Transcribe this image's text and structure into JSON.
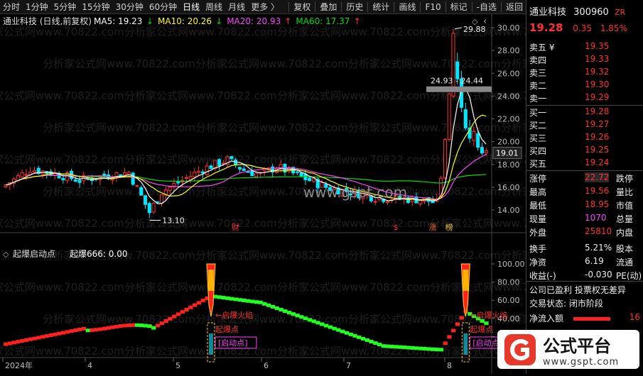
{
  "toolbar": {
    "periods": [
      "分时",
      "1分钟",
      "5分钟",
      "15分钟",
      "30分钟",
      "60分钟",
      "日线",
      "周线",
      "月线",
      "更多 〉"
    ],
    "active_period": "日线",
    "actions": [
      "复权",
      "叠加",
      "历史",
      "统计",
      "画线",
      "F10",
      "标记",
      "-自选",
      "返回"
    ]
  },
  "main_chart": {
    "title": "通业科技 (日线,前复权)",
    "ma": [
      {
        "label": "MA5: 19.23",
        "arrow": "↓",
        "color": "#ffffff"
      },
      {
        "label": "MA10: 20.26",
        "arrow": "↓",
        "color": "#ffff00"
      },
      {
        "label": "MA20: 20.93",
        "arrow": "↑",
        "color": "#ff40ff"
      },
      {
        "label": "MA60: 17.37",
        "arrow": "↑",
        "color": "#00e000"
      }
    ],
    "y_ticks": [
      "30.00",
      "28.00",
      "26.00",
      "24.00",
      "22.00",
      "20.00",
      "18.00",
      "16.00",
      "14.00"
    ],
    "high_label": "29.88",
    "low_label": "13.10",
    "last_price_tag": "19.01",
    "range_label": "24.93 - 24.44",
    "event_marks": [
      "财",
      "$",
      "涨",
      "榜"
    ],
    "watermark": "www.gspt.com"
  },
  "indicator": {
    "title": "起爆启动点",
    "value_label": "起爆666: 0.00",
    "y_ticks": [
      "100.00",
      "80.00",
      "60.00",
      "40.00",
      "20.00"
    ],
    "signals": [
      "启爆火焰",
      "起爆点",
      "启动点"
    ]
  },
  "x_axis": {
    "labels": [
      "2024年",
      "4",
      "5",
      "6",
      "7",
      "8"
    ]
  },
  "watermark_text": "分析家公式网www.70822.com",
  "quote": {
    "name": "通业科技",
    "code": "300960",
    "badge": "ZR",
    "price": "19.28",
    "change": "0.35",
    "pct": "1.85%",
    "asks": [
      {
        "label": "卖五 ¥",
        "price": "19.35"
      },
      {
        "label": "卖四",
        "price": "19.33"
      },
      {
        "label": "卖三",
        "price": "19.32"
      },
      {
        "label": "卖二",
        "price": "19.30"
      },
      {
        "label": "卖一",
        "price": "19.29"
      }
    ],
    "bids": [
      {
        "label": "买一",
        "price": "19.28"
      },
      {
        "label": "买二",
        "price": "19.27"
      },
      {
        "label": "买三",
        "price": "19.26"
      },
      {
        "label": "买四",
        "price": "19.25"
      },
      {
        "label": "买五",
        "price": "19.24"
      }
    ],
    "stats": [
      {
        "label": "涨停",
        "value": "22.72",
        "label2": "跌停",
        "color": "red"
      },
      {
        "label": "最高",
        "value": "19.56",
        "label2": "量比",
        "color": "red"
      },
      {
        "label": "最低",
        "value": "18.95",
        "label2": "市值",
        "color": "red"
      },
      {
        "label": "现量",
        "value": "1070",
        "label2": "总量",
        "color": "mag"
      },
      {
        "label": "外盘",
        "value": "25810",
        "label2": "内盘",
        "color": "red"
      },
      {
        "label": "换手",
        "value": "5.21%",
        "label2": "股本",
        "color": "white"
      },
      {
        "label": "净资",
        "value": "6.19",
        "label2": "流通",
        "color": "white"
      },
      {
        "label": "收益(-)",
        "value": "-0.030",
        "label2": "PE(动)",
        "color": "white"
      }
    ],
    "notes": [
      "公司已盈利 投票权无差异",
      "交易状态: 闭市阶段"
    ],
    "netflow_label": "净流入额",
    "netflow_value": "16"
  },
  "logo": {
    "cn": "公式平台",
    "en": "www.gspt.com"
  }
}
